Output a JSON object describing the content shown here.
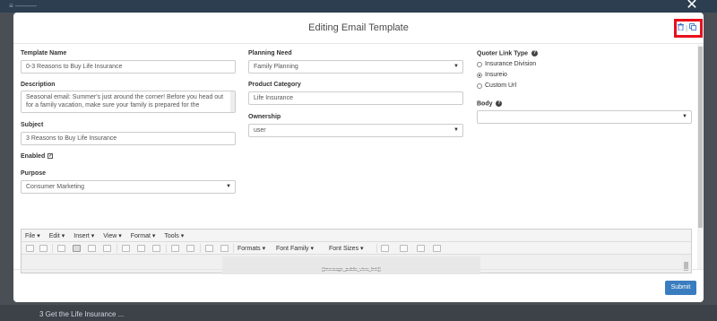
{
  "background": {
    "topbar_text": "≡ ———",
    "bottom_link": "3 Get the Life Insurance ..."
  },
  "modal": {
    "title": "Editing Email Template",
    "close_glyph": "✕",
    "header_icons": [
      "trash-icon",
      "copy-icon"
    ],
    "header_separator": "|"
  },
  "form": {
    "template_name": {
      "label": "Template Name",
      "value": "0-3 Reasons to Buy Life Insurance"
    },
    "description": {
      "label": "Description",
      "line1": "Seasonal email: Summer's just around the corner! Before you head out",
      "line2": "for a family vacation, make sure your family is  prepared for the"
    },
    "subject": {
      "label": "Subject",
      "value": "3 Reasons to Buy Life Insurance"
    },
    "enabled": {
      "label": "Enabled",
      "checked": true
    },
    "purpose": {
      "label": "Purpose",
      "value": "Consumer Marketing"
    },
    "planning_need": {
      "label": "Planning Need",
      "value": "Family Planning"
    },
    "product_category": {
      "label": "Product Category",
      "value": "Life Insurance"
    },
    "ownership": {
      "label": "Ownership",
      "value": "user"
    },
    "quoter_link_type": {
      "label": "Quoter Link Type",
      "options": [
        {
          "label": "Insurance Division",
          "selected": false
        },
        {
          "label": "Insureio",
          "selected": true
        },
        {
          "label": "Custom Url",
          "selected": false
        }
      ]
    },
    "body": {
      "label": "Body",
      "value": ""
    }
  },
  "editor": {
    "menus": [
      "File ▾",
      "Edit ▾",
      "Insert ▾",
      "View ▾",
      "Format ▾",
      "Tools ▾"
    ],
    "dropdowns": {
      "formats": "Formats ▾",
      "font_family": "Font Family ▾",
      "font_sizes": "Font Sizes ▾"
    },
    "placeholder": "{{message_public_view_link}}"
  },
  "footer": {
    "submit_label": "Submit"
  },
  "colors": {
    "accent": "#3a7dbf",
    "highlight": "#e8101c"
  }
}
